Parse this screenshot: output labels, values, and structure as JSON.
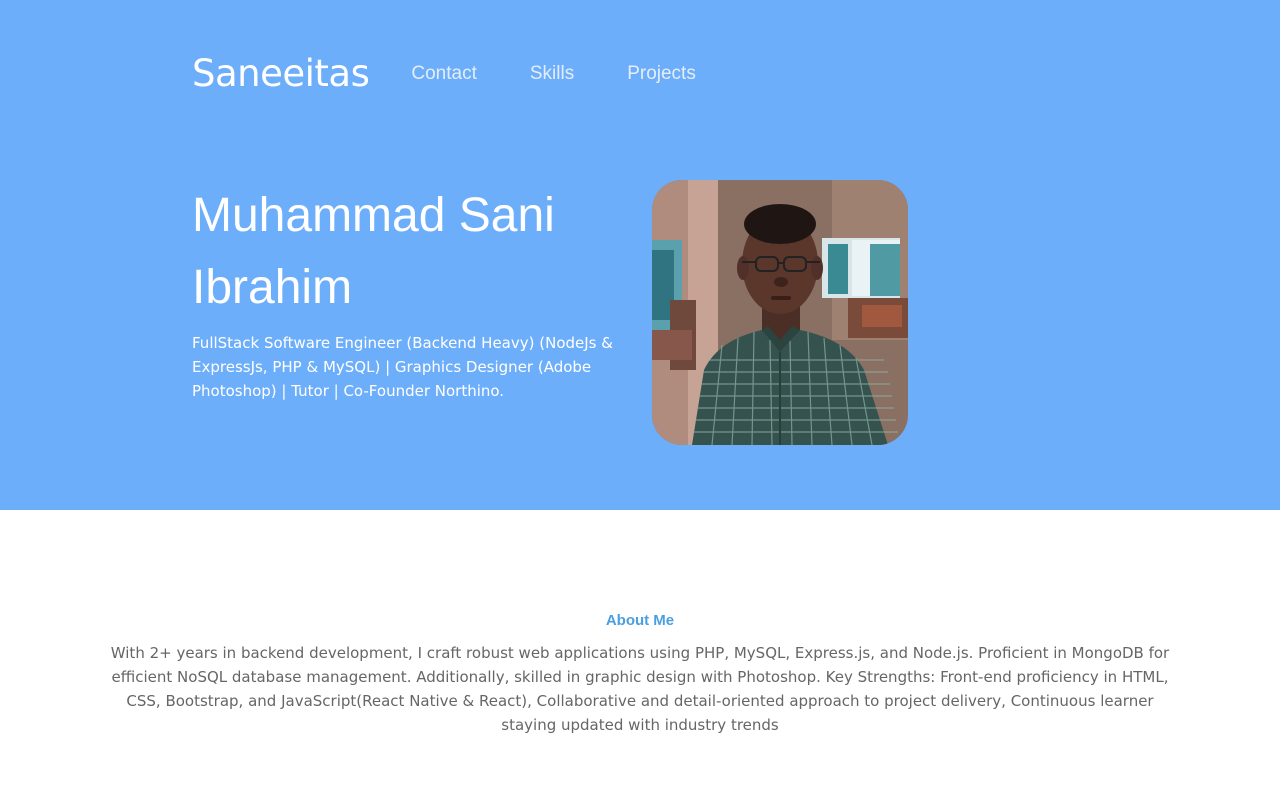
{
  "nav": {
    "brand": "Saneeitas",
    "links": [
      {
        "label": "Contact"
      },
      {
        "label": "Skills"
      },
      {
        "label": "Projects"
      }
    ]
  },
  "hero": {
    "name": "Muhammad Sani Ibrahim",
    "tagline": "FullStack Software Engineer (Backend Heavy) (NodeJs & ExpressJs, PHP & MySQL) | Graphics Designer (Adobe Photoshop) | Tutor | Co-Founder Northino."
  },
  "about": {
    "title": "About Me",
    "text": "With 2+ years in backend development, I craft robust web applications using PHP, MySQL, Express.js, and Node.js. Proficient in MongoDB for efficient NoSQL database management. Additionally, skilled in graphic design with Photoshop. Key Strengths: Front-end proficiency in HTML, CSS, Bootstrap, and JavaScript(React Native & React), Collaborative and detail-oriented approach to project delivery, Continuous learner staying updated with industry trends"
  },
  "colors": {
    "hero_background": "#6daefb",
    "accent": "#4a9fe0",
    "body_text": "#666666"
  }
}
